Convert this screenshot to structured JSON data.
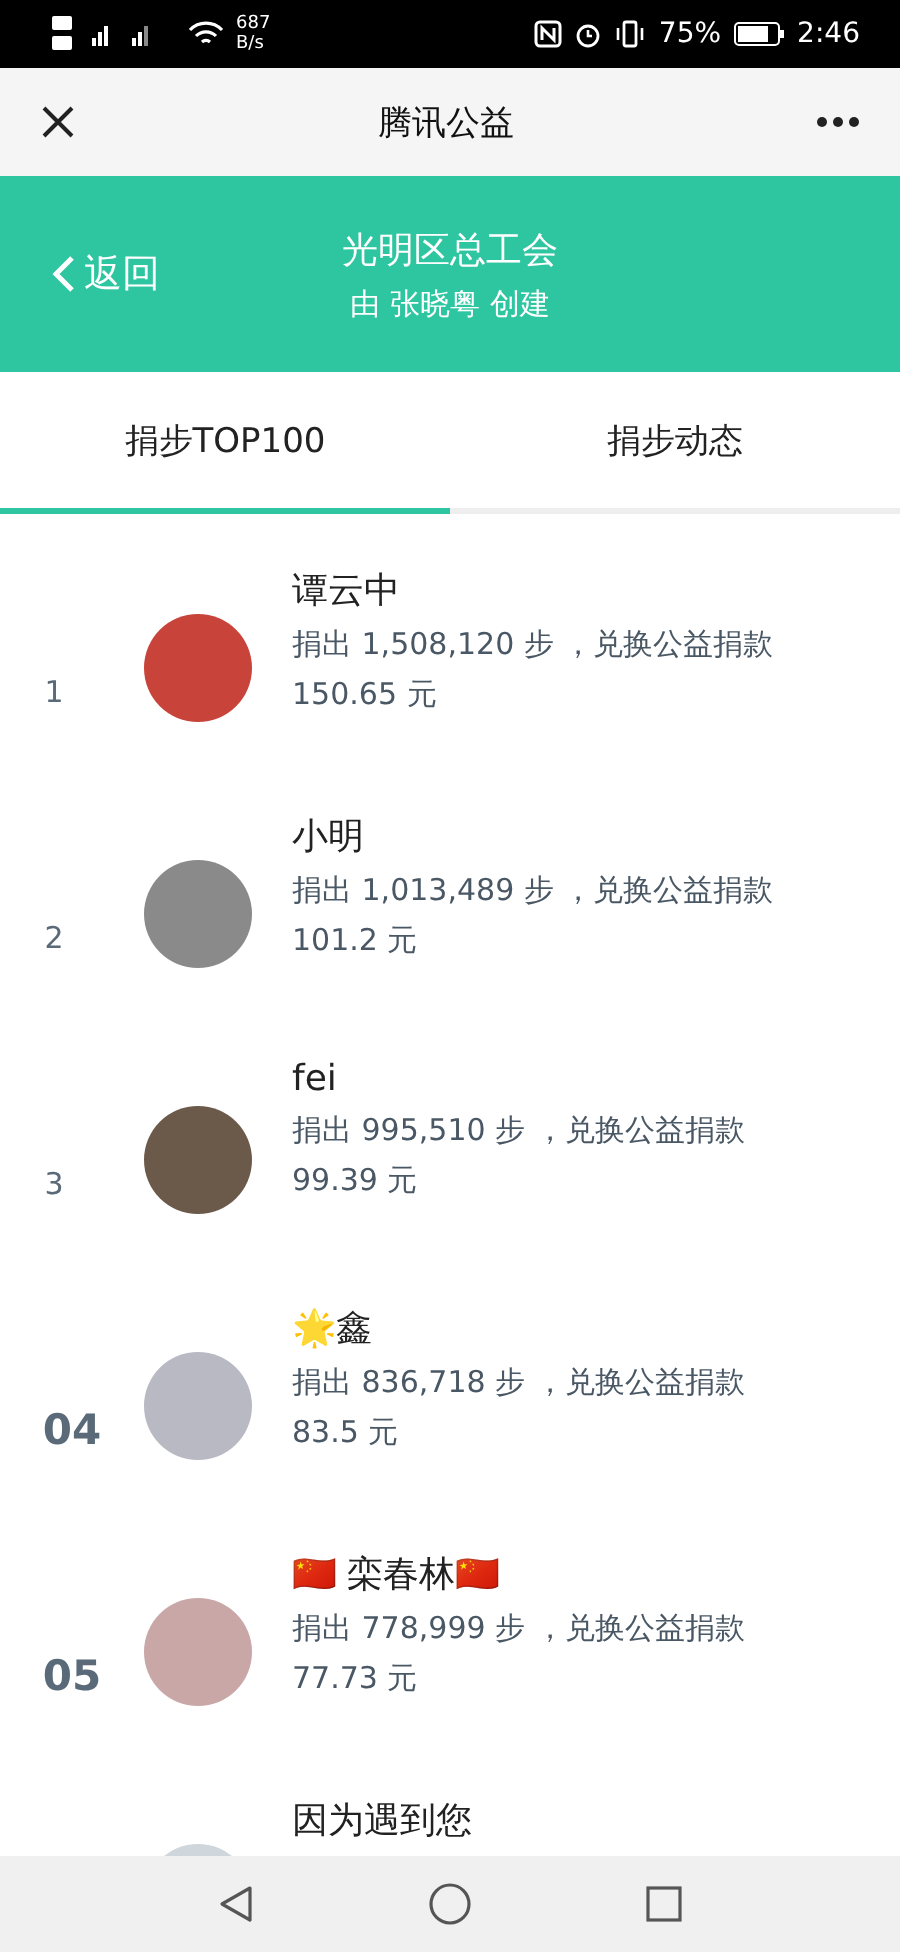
{
  "status_bar": {
    "net_speed": "687",
    "net_unit": "B/s",
    "battery": "75%",
    "time": "2:46"
  },
  "title_bar": {
    "title": "腾讯公益"
  },
  "header": {
    "back": "返回",
    "title": "光明区总工会",
    "subtitle": "由 张晓粤 创建"
  },
  "tabs": [
    {
      "label": "捐步TOP100",
      "selected": true
    },
    {
      "label": "捐步动态",
      "selected": false
    }
  ],
  "ranking": [
    {
      "rank": "1",
      "kind": "top",
      "name": "谭云中",
      "donation": "捐出 1,508,120 步 ，兑换公益捐款",
      "amount": "150.65 元"
    },
    {
      "rank": "2",
      "kind": "top",
      "name": "小明",
      "donation": "捐出 1,013,489 步 ，兑换公益捐款",
      "amount": "101.2 元"
    },
    {
      "rank": "3",
      "kind": "top",
      "name": "fei",
      "donation": "捐出 995,510 步 ，兑换公益捐款",
      "amount": "99.39 元"
    },
    {
      "rank": "04",
      "kind": "plain",
      "name": "🌟鑫",
      "donation": "捐出 836,718 步 ，兑换公益捐款",
      "amount": "83.5 元"
    },
    {
      "rank": "05",
      "kind": "plain",
      "name": "🇨🇳 栾春林🇨🇳",
      "donation": "捐出 778,999 步 ，兑换公益捐款",
      "amount": "77.73 元"
    },
    {
      "kind": "plain",
      "name": "因为遇到您"
    }
  ]
}
